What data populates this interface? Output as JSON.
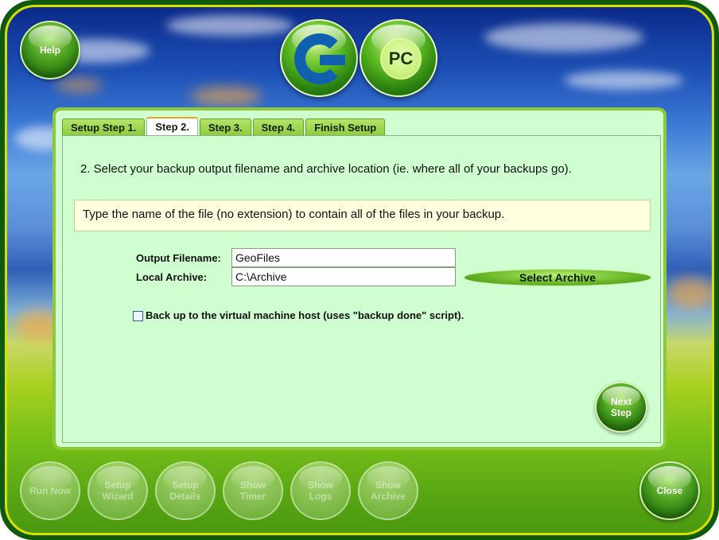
{
  "app": {
    "logo_letters": "G",
    "logo_pc": "PC"
  },
  "top": {
    "help_label": "Help"
  },
  "tabs": [
    {
      "label": "Setup Step 1."
    },
    {
      "label": "Step 2.",
      "active": true
    },
    {
      "label": "Step 3."
    },
    {
      "label": "Step 4."
    },
    {
      "label": "Finish Setup"
    }
  ],
  "step2": {
    "instruction": "2. Select your backup output filename and archive location (ie. where all of your backups go).",
    "hint": "Type the name of the file (no extension) to contain all of the files in your backup.",
    "output_filename_label": "Output Filename:",
    "output_filename_value": "GeoFiles",
    "local_archive_label": "Local Archive:",
    "local_archive_value": "C:\\Archive",
    "select_archive_label": "Select Archive",
    "vm_checkbox_label": "Back up to the virtual machine host (uses \"backup done\" script).",
    "vm_checkbox_checked": false,
    "next_step_line1": "Next",
    "next_step_line2": "Step"
  },
  "bottom": {
    "run_now": "Run Now",
    "setup_wizard_1": "Setup",
    "setup_wizard_2": "Wizard",
    "setup_details_1": "Setup",
    "setup_details_2": "Details",
    "show_timer_1": "Show",
    "show_timer_2": "Timer",
    "show_logs_1": "Show",
    "show_logs_2": "Logs",
    "show_archive_1": "Show",
    "show_archive_2": "Archive",
    "close": "Close"
  },
  "colors": {
    "frame": "#0f5a0f",
    "frame_border": "#d8e000",
    "panel": "#8cc83a",
    "panel_bg": "#cfffd0",
    "hint_bg": "#ffffe0",
    "logo_blue": "#1060b0"
  }
}
